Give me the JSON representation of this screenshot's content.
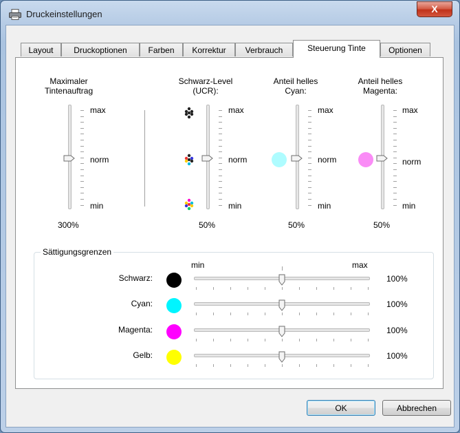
{
  "window": {
    "title": "Druckeinstellungen",
    "close_label": "X"
  },
  "tabs": [
    {
      "label": "Layout"
    },
    {
      "label": "Druckoptionen"
    },
    {
      "label": "Farben"
    },
    {
      "label": "Korrektur"
    },
    {
      "label": "Verbrauch"
    },
    {
      "label": "Steuerung Tinte",
      "active": true
    },
    {
      "label": "Optionen"
    }
  ],
  "ink": {
    "max_label": "max",
    "norm_label": "norm",
    "min_label": "min",
    "columns": [
      {
        "title_line1": "Maximaler",
        "title_line2": "Tintenauftrag",
        "value": "300%",
        "level": 0.5
      },
      {
        "title_line1": "Schwarz-Level",
        "title_line2": "(UCR):",
        "value": "50%",
        "level": 0.5
      },
      {
        "title_line1": "Anteil helles",
        "title_line2": "Cyan:",
        "value": "50%",
        "level": 0.5,
        "swatch_color": "#aefcff"
      },
      {
        "title_line1": "Anteil helles",
        "title_line2": "Magenta:",
        "value": "50%",
        "level": 0.5,
        "swatch_color": "#fa8cf6"
      }
    ]
  },
  "saturation": {
    "title": "Sättigungsgrenzen",
    "min_label": "min",
    "max_label": "max",
    "rows": [
      {
        "label": "Schwarz:",
        "color": "#000000",
        "value": "100%",
        "level": 0.5
      },
      {
        "label": "Cyan:",
        "color": "#00f5ff",
        "value": "100%",
        "level": 0.5
      },
      {
        "label": "Magenta:",
        "color": "#ff00ff",
        "value": "100%",
        "level": 0.5
      },
      {
        "label": "Gelb:",
        "color": "#ffff00",
        "value": "100%",
        "level": 0.5
      }
    ]
  },
  "buttons": {
    "ok": "OK",
    "cancel": "Abbrechen"
  }
}
